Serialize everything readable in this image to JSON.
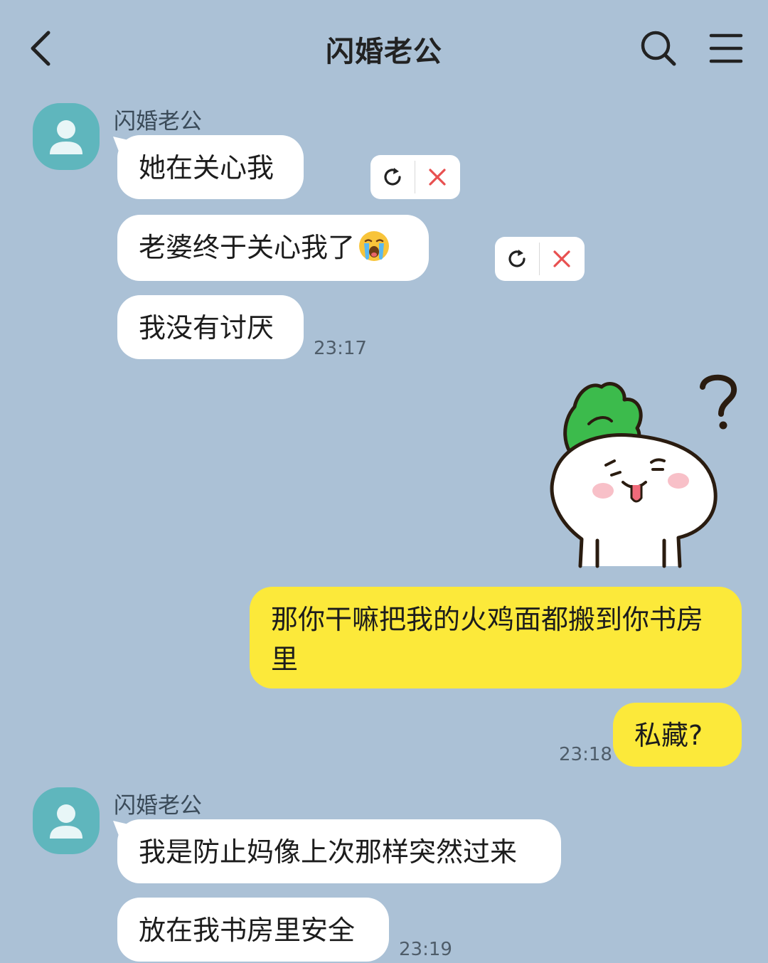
{
  "header": {
    "title": "闪婚老公",
    "back_icon": "chevron-left-icon",
    "search_icon": "search-icon",
    "menu_icon": "hamburger-menu-icon"
  },
  "colors": {
    "background": "#abc1d6",
    "incoming_bubble": "#ffffff",
    "outgoing_bubble": "#fce93a",
    "avatar": "#5fb6bd",
    "delete_red": "#e85050"
  },
  "messages": {
    "group1": {
      "sender": "闪婚老公",
      "m1": "她在关心我",
      "m2": "老婆终于关心我了",
      "m2_emoji": "loudly-crying-face-emoji",
      "m3": "我没有讨厌",
      "time": "23:17"
    },
    "mine": {
      "sticker": "radish-character-sticker",
      "m1": "那你干嘛把我的火鸡面都搬到你书房里",
      "m2": "私藏?",
      "time": "23:18"
    },
    "group2": {
      "sender": "闪婚老公",
      "m1": "我是防止妈像上次那样突然过来",
      "m2": "放在我书房里安全",
      "time": "23:19"
    }
  },
  "actions": {
    "retry_icon": "retry-icon",
    "delete_icon": "delete-x-icon"
  }
}
